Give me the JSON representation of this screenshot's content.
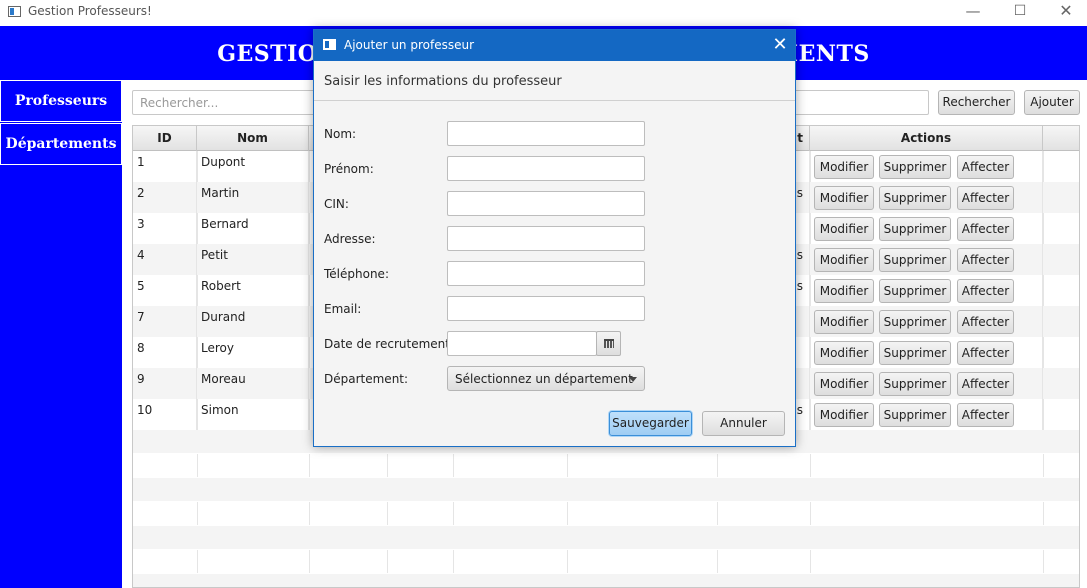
{
  "window": {
    "title": "Gestion Professeurs!",
    "minimize_glyph": "—",
    "maximize_glyph": "☐",
    "close_glyph": "✕"
  },
  "header": {
    "title": "GESTION DES PROFESSEURS ET DÉPARTEMENTS"
  },
  "sidebar": {
    "items": [
      {
        "label": "Professeurs"
      },
      {
        "label": "Départements"
      }
    ]
  },
  "toolbar": {
    "search_placeholder": "Rechercher...",
    "search_value": "",
    "search_button": "Rechercher",
    "add_button": "Ajouter"
  },
  "table": {
    "columns": [
      "ID",
      "Nom",
      "",
      "",
      "",
      "",
      "t",
      "Actions"
    ],
    "action_labels": {
      "modify": "Modifier",
      "delete": "Supprimer",
      "assign": "Affecter"
    },
    "rows": [
      {
        "id": "1",
        "nom": "Dupont",
        "partial_c7": ""
      },
      {
        "id": "2",
        "nom": "Martin",
        "partial_c7": "s"
      },
      {
        "id": "3",
        "nom": "Bernard",
        "partial_c7": ""
      },
      {
        "id": "4",
        "nom": "Petit",
        "partial_c7": "s"
      },
      {
        "id": "5",
        "nom": "Robert",
        "partial_c7": "s"
      },
      {
        "id": "7",
        "nom": "Durand",
        "partial_c7": ""
      },
      {
        "id": "8",
        "nom": "Leroy",
        "partial_c7": ""
      },
      {
        "id": "9",
        "nom": "Moreau",
        "partial_c7": ""
      },
      {
        "id": "10",
        "nom": "Simon",
        "partial_c7": "s"
      }
    ]
  },
  "dialog": {
    "title": "Ajouter un professeur",
    "close_glyph": "✕",
    "header": "Saisir les informations du professeur",
    "fields": [
      {
        "label": "Nom:",
        "value": ""
      },
      {
        "label": "Prénom:",
        "value": ""
      },
      {
        "label": "CIN:",
        "value": ""
      },
      {
        "label": "Adresse:",
        "value": ""
      },
      {
        "label": "Téléphone:",
        "value": ""
      },
      {
        "label": "Email:",
        "value": ""
      }
    ],
    "date_label": "Date de recrutement:",
    "date_value": "",
    "department_label": "Département:",
    "department_selected": "Sélectionnez un département",
    "save_button": "Sauvegarder",
    "cancel_button": "Annuler"
  }
}
